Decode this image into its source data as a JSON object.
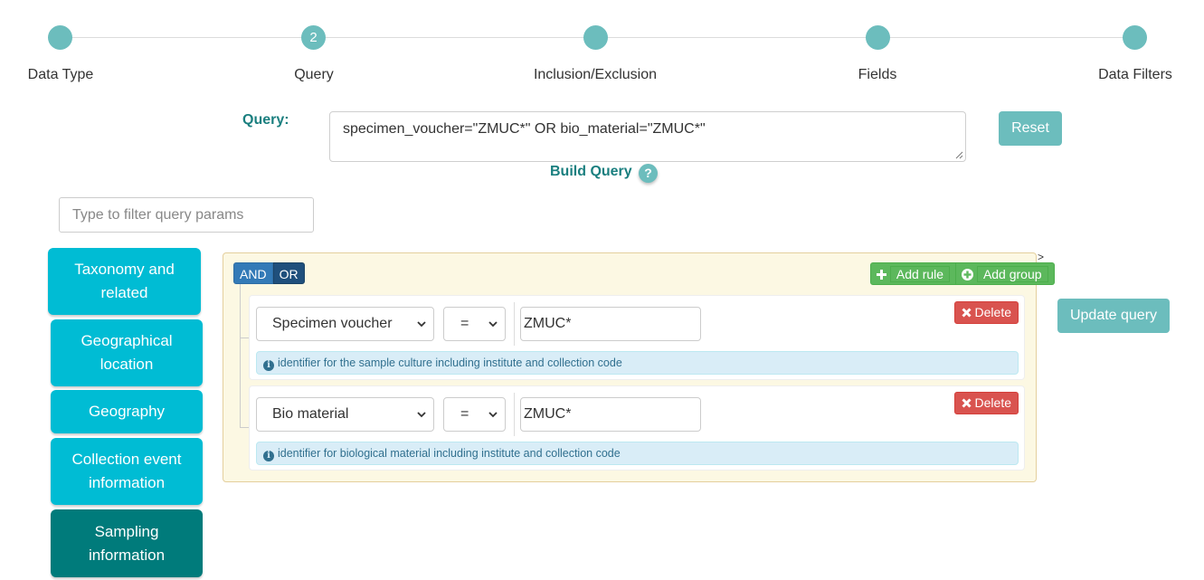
{
  "stepper": {
    "steps": [
      {
        "label": "Data Type",
        "number": ""
      },
      {
        "label": "Query",
        "number": "2"
      },
      {
        "label": "Inclusion/Exclusion",
        "number": ""
      },
      {
        "label": "Fields",
        "number": ""
      },
      {
        "label": "Data Filters",
        "number": ""
      }
    ],
    "accent_color": "#6cbdbd"
  },
  "query": {
    "label": "Query:",
    "value": "specimen_voucher=\"ZMUC*\" OR bio_material=\"ZMUC*\"",
    "reset_label": "Reset",
    "build_label": "Build Query",
    "help_glyph": "?"
  },
  "filter": {
    "placeholder": "Type to filter query params"
  },
  "sidebar": {
    "items": [
      {
        "label": "Taxonomy and related"
      },
      {
        "label": "Geographical location"
      },
      {
        "label": "Geography"
      },
      {
        "label": "Collection event information"
      },
      {
        "label": "Sampling information",
        "active": true
      }
    ]
  },
  "builder": {
    "and_label": "AND",
    "or_label": "OR",
    "add_rule_label": "Add rule",
    "add_group_label": "Add group",
    "corner_mark": ">",
    "rules": [
      {
        "field": "Specimen voucher",
        "operator": "=",
        "value": "ZMUC*",
        "delete_label": "Delete",
        "hint": "identifier for the sample culture including institute and collection code"
      },
      {
        "field": "Bio material",
        "operator": "=",
        "value": "ZMUC*",
        "delete_label": "Delete",
        "hint": "identifier for biological material including institute and collection code"
      }
    ]
  },
  "update_label": "Update query"
}
